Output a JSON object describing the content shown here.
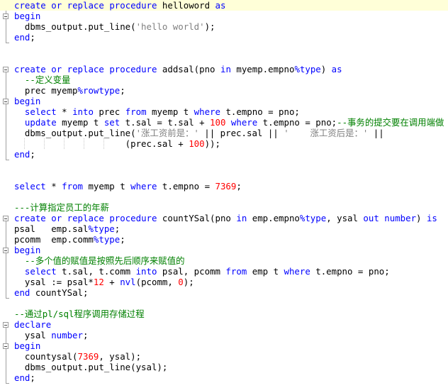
{
  "editor": {
    "lines": [
      [
        [
          "keyword",
          "create"
        ],
        [
          "ident",
          " "
        ],
        [
          "keyword",
          "or"
        ],
        [
          "ident",
          " "
        ],
        [
          "keyword",
          "replace"
        ],
        [
          "ident",
          " "
        ],
        [
          "keyword",
          "procedure"
        ],
        [
          "ident",
          " helloword "
        ],
        [
          "keyword",
          "as"
        ]
      ],
      [
        [
          "keyword",
          "begin"
        ]
      ],
      [
        [
          "ident",
          "  dbms_output.put_line("
        ],
        [
          "string",
          "'hello world'"
        ],
        [
          "ident",
          ");"
        ]
      ],
      [
        [
          "keyword",
          "end"
        ],
        [
          "ident",
          ";"
        ]
      ],
      [],
      [],
      [
        [
          "keyword",
          "create"
        ],
        [
          "ident",
          " "
        ],
        [
          "keyword",
          "or"
        ],
        [
          "ident",
          " "
        ],
        [
          "keyword",
          "replace"
        ],
        [
          "ident",
          " "
        ],
        [
          "keyword",
          "procedure"
        ],
        [
          "ident",
          " addsal(pno "
        ],
        [
          "keyword",
          "in"
        ],
        [
          "ident",
          " myemp.empno"
        ],
        [
          "keyword",
          "%type"
        ],
        [
          "ident",
          ") "
        ],
        [
          "keyword",
          "as"
        ]
      ],
      [
        [
          "comment",
          "  --定义变量"
        ]
      ],
      [
        [
          "ident",
          "  prec myemp"
        ],
        [
          "keyword",
          "%rowtype"
        ],
        [
          "ident",
          ";"
        ]
      ],
      [
        [
          "keyword",
          "begin"
        ]
      ],
      [
        [
          "ident",
          "  "
        ],
        [
          "keyword",
          "select"
        ],
        [
          "ident",
          " * "
        ],
        [
          "keyword",
          "into"
        ],
        [
          "ident",
          " prec "
        ],
        [
          "keyword",
          "from"
        ],
        [
          "ident",
          " myemp t "
        ],
        [
          "keyword",
          "where"
        ],
        [
          "ident",
          " t.empno = pno;"
        ]
      ],
      [
        [
          "ident",
          "  "
        ],
        [
          "keyword",
          "update"
        ],
        [
          "ident",
          " myemp t "
        ],
        [
          "keyword",
          "set"
        ],
        [
          "ident",
          " t.sal = t.sal + "
        ],
        [
          "number",
          "100"
        ],
        [
          "ident",
          " "
        ],
        [
          "keyword",
          "where"
        ],
        [
          "ident",
          " t.empno = pno;"
        ],
        [
          "comment",
          "--事务的提交要在调用端做"
        ]
      ],
      [
        [
          "ident",
          "  dbms_output.put_line("
        ],
        [
          "string",
          "'涨工资前是：'"
        ],
        [
          "ident",
          " || prec.sal || "
        ],
        [
          "string",
          "'    涨工资后是：'"
        ],
        [
          "ident",
          " ||"
        ]
      ],
      [
        [
          "ident",
          "                     (prec.sal + "
        ],
        [
          "number",
          "100"
        ],
        [
          "ident",
          "));"
        ]
      ],
      [
        [
          "keyword",
          "end"
        ],
        [
          "ident",
          ";"
        ]
      ],
      [],
      [],
      [
        [
          "keyword",
          "select"
        ],
        [
          "ident",
          " * "
        ],
        [
          "keyword",
          "from"
        ],
        [
          "ident",
          " myemp t "
        ],
        [
          "keyword",
          "where"
        ],
        [
          "ident",
          " t.empno = "
        ],
        [
          "number",
          "7369"
        ],
        [
          "ident",
          ";"
        ]
      ],
      [],
      [
        [
          "comment",
          "---计算指定员工的年薪"
        ]
      ],
      [
        [
          "keyword",
          "create"
        ],
        [
          "ident",
          " "
        ],
        [
          "keyword",
          "or"
        ],
        [
          "ident",
          " "
        ],
        [
          "keyword",
          "replace"
        ],
        [
          "ident",
          " "
        ],
        [
          "keyword",
          "procedure"
        ],
        [
          "ident",
          " countYSal(pno "
        ],
        [
          "keyword",
          "in"
        ],
        [
          "ident",
          " emp.empno"
        ],
        [
          "keyword",
          "%type"
        ],
        [
          "ident",
          ", ysal "
        ],
        [
          "keyword",
          "out"
        ],
        [
          "ident",
          " "
        ],
        [
          "keyword",
          "number"
        ],
        [
          "ident",
          ") "
        ],
        [
          "keyword",
          "is"
        ]
      ],
      [
        [
          "ident",
          "psal   emp.sal"
        ],
        [
          "keyword",
          "%type"
        ],
        [
          "ident",
          ";"
        ]
      ],
      [
        [
          "ident",
          "pcomm  emp.comm"
        ],
        [
          "keyword",
          "%type"
        ],
        [
          "ident",
          ";"
        ]
      ],
      [
        [
          "keyword",
          "begin"
        ]
      ],
      [
        [
          "comment",
          "  --多个值的赋值是按照先后顺序来赋值的"
        ]
      ],
      [
        [
          "ident",
          "  "
        ],
        [
          "keyword",
          "select"
        ],
        [
          "ident",
          " t.sal, t.comm "
        ],
        [
          "keyword",
          "into"
        ],
        [
          "ident",
          " psal, pcomm "
        ],
        [
          "keyword",
          "from"
        ],
        [
          "ident",
          " emp t "
        ],
        [
          "keyword",
          "where"
        ],
        [
          "ident",
          " t.empno = pno;"
        ]
      ],
      [
        [
          "ident",
          "  ysal := psal*"
        ],
        [
          "number",
          "12"
        ],
        [
          "ident",
          " + "
        ],
        [
          "keyword",
          "nvl"
        ],
        [
          "ident",
          "(pcomm, "
        ],
        [
          "number",
          "0"
        ],
        [
          "ident",
          ");"
        ]
      ],
      [
        [
          "keyword",
          "end"
        ],
        [
          "ident",
          " countYSal;"
        ]
      ],
      [],
      [
        [
          "comment",
          "--通过pl/sql程序调用存储过程"
        ]
      ],
      [
        [
          "keyword",
          "declare"
        ]
      ],
      [
        [
          "ident",
          "  ysal "
        ],
        [
          "keyword",
          "number"
        ],
        [
          "ident",
          ";"
        ]
      ],
      [
        [
          "keyword",
          "begin"
        ]
      ],
      [
        [
          "ident",
          "  countysal("
        ],
        [
          "number",
          "7369"
        ],
        [
          "ident",
          ", ysal);"
        ]
      ],
      [
        [
          "ident",
          "  dbms_output.put_line(ysal);"
        ]
      ],
      [
        [
          "keyword",
          "end"
        ],
        [
          "ident",
          ";"
        ]
      ]
    ]
  }
}
